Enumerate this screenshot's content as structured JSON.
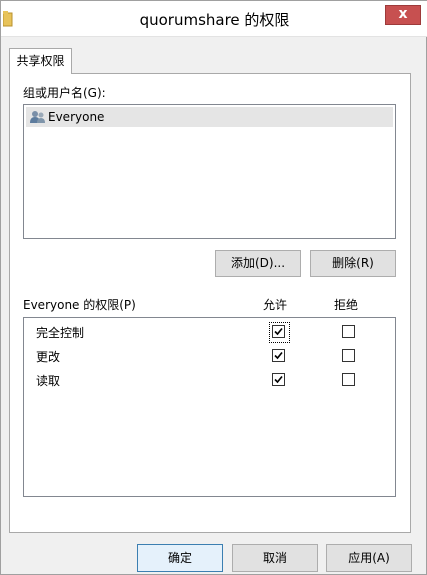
{
  "window": {
    "title": "quorumshare 的权限",
    "close_label": "x"
  },
  "tabs": [
    {
      "label": "共享权限",
      "active": true
    }
  ],
  "groups": {
    "label": "组或用户名(G):",
    "items": [
      {
        "name": "Everyone",
        "icon": "users-group-icon",
        "selected": true
      }
    ]
  },
  "actions": {
    "add_label": "添加(D)...",
    "remove_label": "删除(R)"
  },
  "permissions": {
    "label": "Everyone 的权限(P)",
    "allow_header": "允许",
    "deny_header": "拒绝",
    "rows": [
      {
        "name": "完全控制",
        "allow": true,
        "deny": false
      },
      {
        "name": "更改",
        "allow": true,
        "deny": false
      },
      {
        "name": "读取",
        "allow": true,
        "deny": false
      }
    ]
  },
  "footer": {
    "ok_label": "确定",
    "cancel_label": "取消",
    "apply_label": "应用(A)"
  }
}
